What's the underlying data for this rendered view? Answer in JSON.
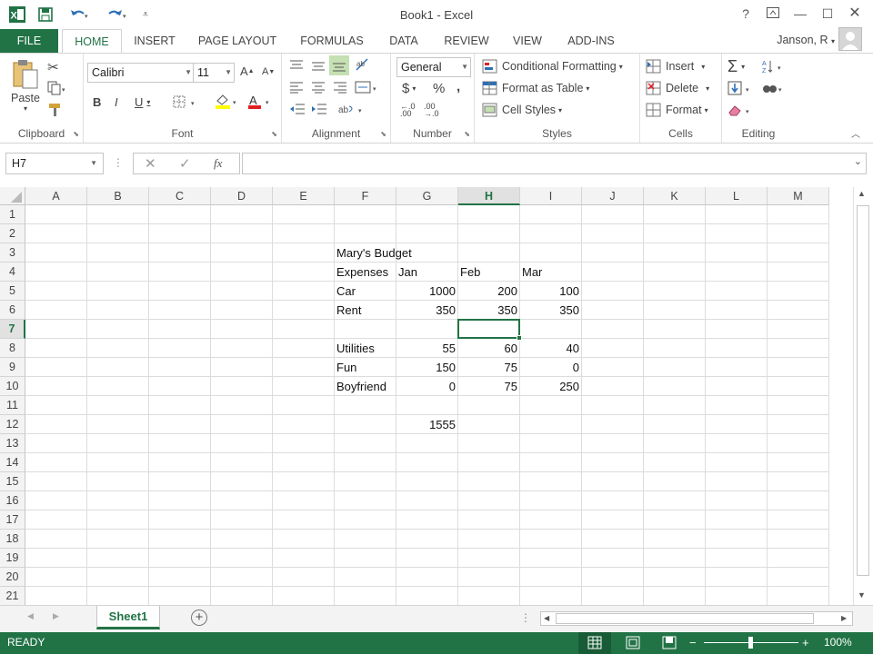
{
  "window": {
    "title": "Book1 - Excel",
    "user": "Janson, R",
    "help": "?"
  },
  "tabs": [
    {
      "label": "FILE"
    },
    {
      "label": "HOME"
    },
    {
      "label": "INSERT"
    },
    {
      "label": "PAGE LAYOUT"
    },
    {
      "label": "FORMULAS"
    },
    {
      "label": "DATA"
    },
    {
      "label": "REVIEW"
    },
    {
      "label": "VIEW"
    },
    {
      "label": "ADD-INS"
    }
  ],
  "ribbon": {
    "clipboard": {
      "label": "Clipboard",
      "paste": "Paste"
    },
    "font": {
      "label": "Font",
      "name": "Calibri",
      "size": "11"
    },
    "alignment": {
      "label": "Alignment"
    },
    "number": {
      "label": "Number",
      "format": "General"
    },
    "styles": {
      "label": "Styles",
      "conditional": "Conditional Formatting",
      "table": "Format as Table",
      "cellstyles": "Cell Styles"
    },
    "cells": {
      "label": "Cells",
      "insert": "Insert",
      "delete": "Delete",
      "format": "Format"
    },
    "editing": {
      "label": "Editing"
    }
  },
  "formula_bar": {
    "name_box": "H7",
    "formula": "",
    "fx": "fx"
  },
  "columns": [
    "A",
    "B",
    "C",
    "D",
    "E",
    "F",
    "G",
    "H",
    "I",
    "J",
    "K",
    "L",
    "M"
  ],
  "rows": [
    "1",
    "2",
    "3",
    "4",
    "5",
    "6",
    "7",
    "8",
    "9",
    "10",
    "11",
    "12",
    "13",
    "14",
    "15",
    "16",
    "17",
    "18",
    "19",
    "20",
    "21"
  ],
  "cells": [
    {
      "ref": "F3",
      "value": "Mary's Budget",
      "type": "text"
    },
    {
      "ref": "F4",
      "value": "Expenses",
      "type": "text"
    },
    {
      "ref": "G4",
      "value": "Jan",
      "type": "text"
    },
    {
      "ref": "H4",
      "value": "Feb",
      "type": "text"
    },
    {
      "ref": "I4",
      "value": "Mar",
      "type": "text"
    },
    {
      "ref": "F5",
      "value": "Car",
      "type": "text"
    },
    {
      "ref": "G5",
      "value": "1000",
      "type": "num"
    },
    {
      "ref": "H5",
      "value": "200",
      "type": "num"
    },
    {
      "ref": "I5",
      "value": "100",
      "type": "num"
    },
    {
      "ref": "F6",
      "value": "Rent",
      "type": "text"
    },
    {
      "ref": "G6",
      "value": "350",
      "type": "num"
    },
    {
      "ref": "H6",
      "value": "350",
      "type": "num"
    },
    {
      "ref": "I6",
      "value": "350",
      "type": "num"
    },
    {
      "ref": "F8",
      "value": "Utilities",
      "type": "text"
    },
    {
      "ref": "G8",
      "value": "55",
      "type": "num"
    },
    {
      "ref": "H8",
      "value": "60",
      "type": "num"
    },
    {
      "ref": "I8",
      "value": "40",
      "type": "num"
    },
    {
      "ref": "F9",
      "value": "Fun",
      "type": "text"
    },
    {
      "ref": "G9",
      "value": "150",
      "type": "num"
    },
    {
      "ref": "H9",
      "value": "75",
      "type": "num"
    },
    {
      "ref": "I9",
      "value": "0",
      "type": "num"
    },
    {
      "ref": "F10",
      "value": "Boyfriend",
      "type": "text"
    },
    {
      "ref": "G10",
      "value": "0",
      "type": "num"
    },
    {
      "ref": "H10",
      "value": "75",
      "type": "num"
    },
    {
      "ref": "I10",
      "value": "250",
      "type": "num"
    },
    {
      "ref": "G12",
      "value": "1555",
      "type": "num"
    }
  ],
  "selection": {
    "cell": "H7",
    "column": "H",
    "row": "7"
  },
  "sheets": [
    {
      "label": "Sheet1",
      "active": true
    }
  ],
  "status": {
    "mode": "READY",
    "zoom": "100%"
  },
  "colors": {
    "accent": "#217346"
  }
}
